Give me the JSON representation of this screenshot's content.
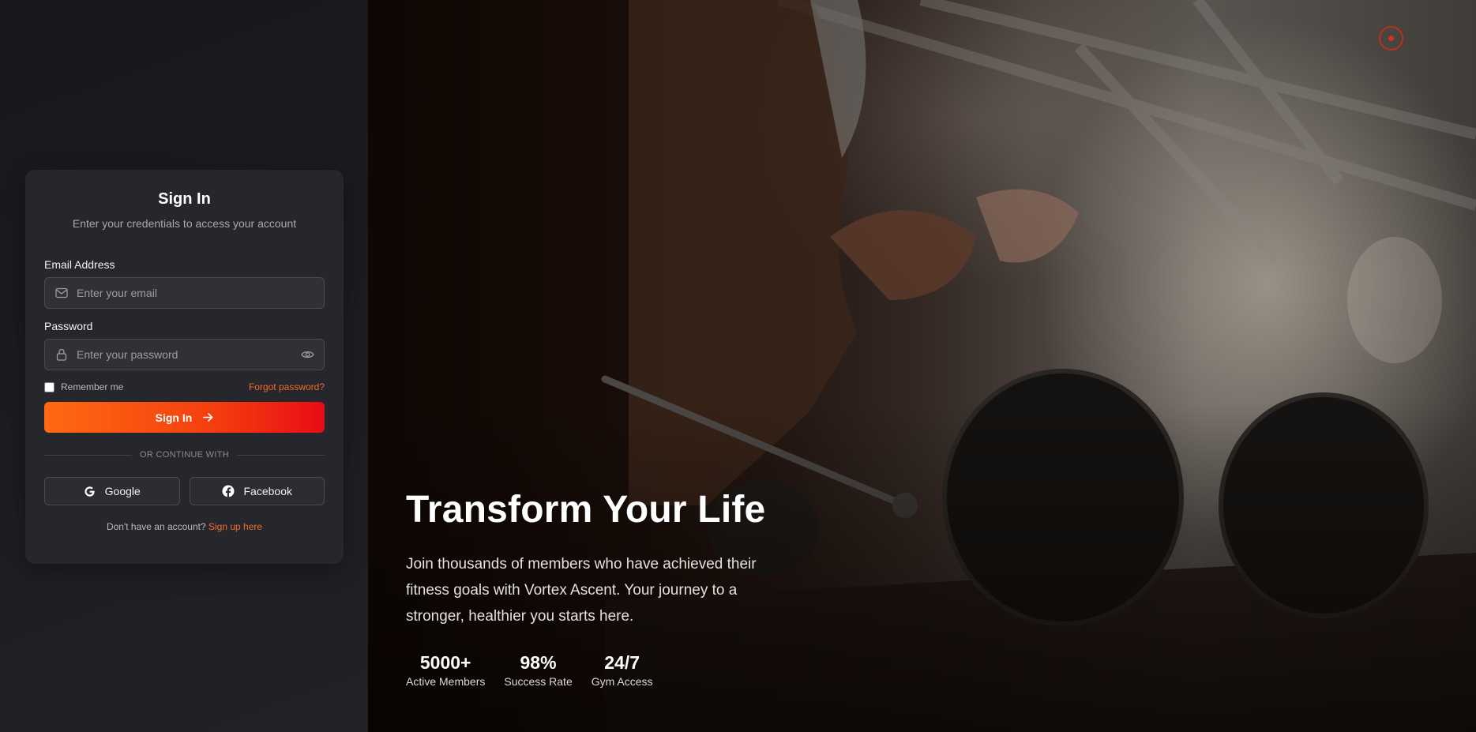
{
  "signin_card": {
    "title": "Sign In",
    "subtitle": "Enter your credentials to access your account",
    "email": {
      "label": "Email Address",
      "placeholder": "Enter your email",
      "value": "",
      "icon": "mail-icon"
    },
    "password": {
      "label": "Password",
      "placeholder": "Enter your password",
      "value": "",
      "icon": "lock-icon",
      "toggle_icon": "eye-icon"
    },
    "remember_label": "Remember me",
    "remember_checked": false,
    "forgot_label": "Forgot password?",
    "submit_label": "Sign In",
    "divider_text": "OR CONTINUE WITH",
    "social": [
      {
        "label": "Google",
        "icon": "google-icon"
      },
      {
        "label": "Facebook",
        "icon": "facebook-icon"
      }
    ],
    "signup_prompt": "Don't have an account?",
    "signup_link": "Sign up here"
  },
  "hero": {
    "title": "Transform Your Life",
    "description": "Join thousands of members who have achieved their fitness goals with Vortex Ascent. Your journey to a stronger, healthier you starts here.",
    "stats": [
      {
        "value": "5000+",
        "label": "Active Members"
      },
      {
        "value": "98%",
        "label": "Success Rate"
      },
      {
        "value": "24/7",
        "label": "Gym Access"
      }
    ]
  },
  "colors": {
    "accent": "#ff6a12",
    "accent_end": "#e80c14",
    "link": "#f26b2a",
    "card_bg": "#26272c",
    "page_bg": "#16181d"
  }
}
